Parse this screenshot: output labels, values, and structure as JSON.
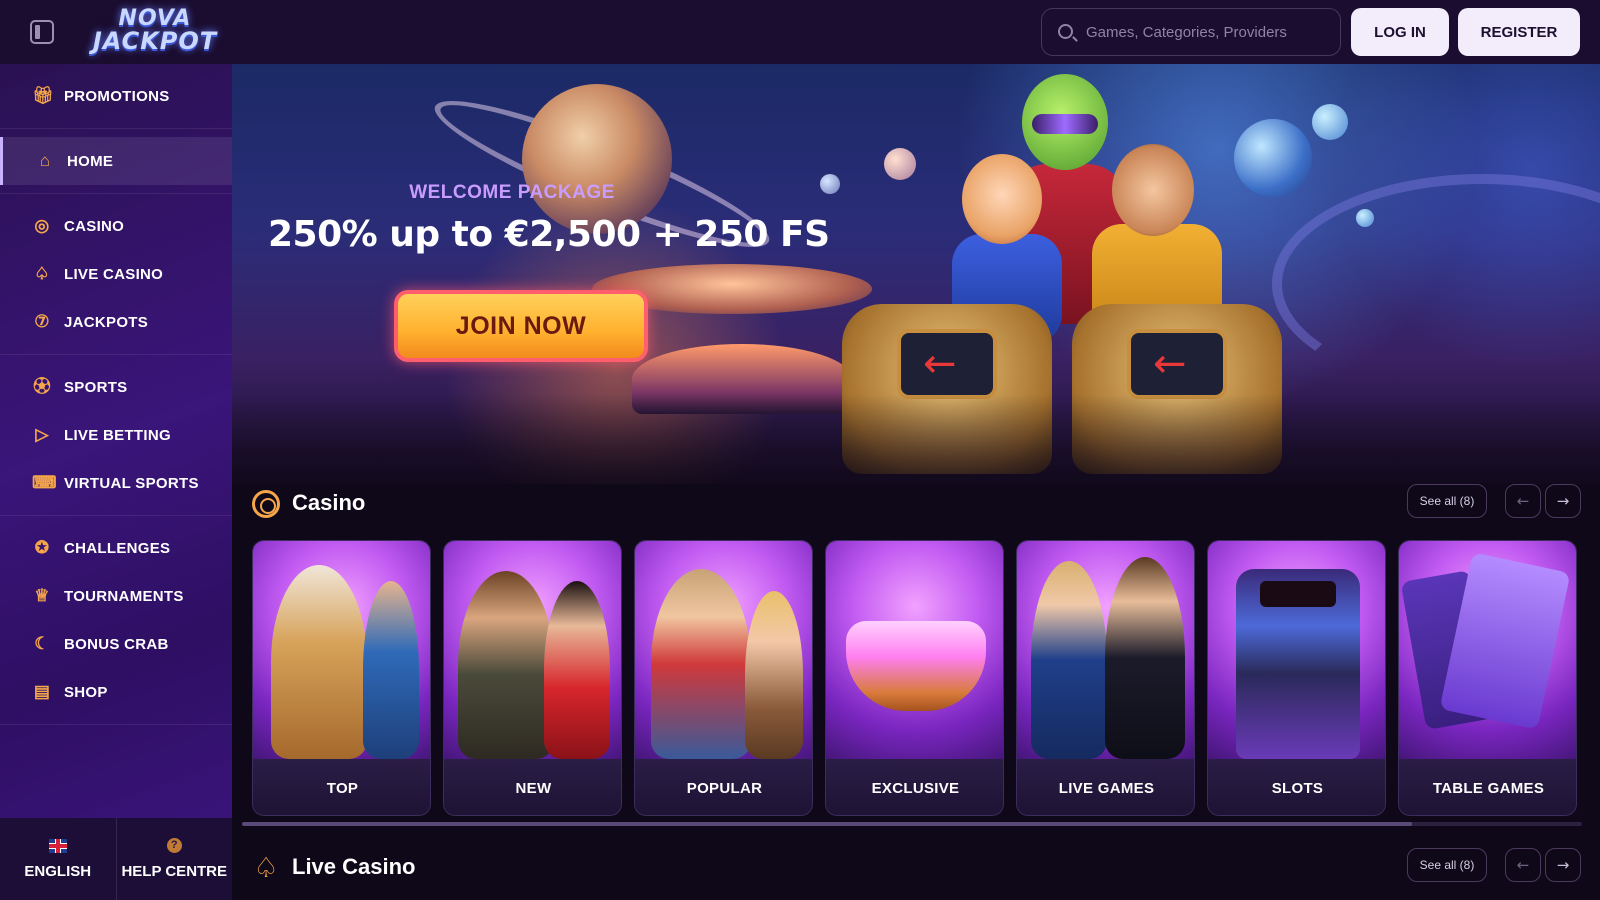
{
  "header": {
    "logo_line1": "NOVA",
    "logo_line2": "JACKPOT",
    "search_placeholder": "Games, Categories, Providers",
    "login_label": "LOG IN",
    "register_label": "REGISTER"
  },
  "sidebar": {
    "groups": [
      [
        {
          "label": "PROMOTIONS",
          "icon": "gift-icon"
        }
      ],
      [
        {
          "label": "HOME",
          "icon": "home-icon",
          "active": true
        }
      ],
      [
        {
          "label": "CASINO",
          "icon": "casino-chip-icon"
        },
        {
          "label": "LIVE CASINO",
          "icon": "spade-icon"
        },
        {
          "label": "JACKPOTS",
          "icon": "seven-icon"
        }
      ],
      [
        {
          "label": "SPORTS",
          "icon": "soccer-ball-icon"
        },
        {
          "label": "LIVE BETTING",
          "icon": "play-icon"
        },
        {
          "label": "VIRTUAL SPORTS",
          "icon": "gamepad-icon"
        }
      ],
      [
        {
          "label": "CHALLENGES",
          "icon": "medal-icon"
        },
        {
          "label": "TOURNAMENTS",
          "icon": "trophy-icon"
        },
        {
          "label": "BONUS CRAB",
          "icon": "crab-icon"
        },
        {
          "label": "SHOP",
          "icon": "shop-icon"
        }
      ]
    ],
    "footer": {
      "language": "ENGLISH",
      "help": "HELP CENTRE"
    }
  },
  "hero": {
    "subtitle": "WELCOME PACKAGE",
    "title": "250% up to €2,500 + 250 FS",
    "cta": "JOIN NOW"
  },
  "sections": {
    "casino": {
      "title": "Casino",
      "see_all": "See all (8)",
      "cards": [
        "TOP",
        "NEW",
        "POPULAR",
        "EXCLUSIVE",
        "LIVE GAMES",
        "SLOTS",
        "TABLE GAMES"
      ]
    },
    "live_casino": {
      "title": "Live Casino",
      "see_all": "See all (8)"
    }
  },
  "colors": {
    "accent_orange": "#f5a64a",
    "sidebar_purple": "#3a157a",
    "cta_yellow": "#ffb02e",
    "cta_border": "#ff5f6d",
    "subtitle_purple": "#c99cff"
  }
}
